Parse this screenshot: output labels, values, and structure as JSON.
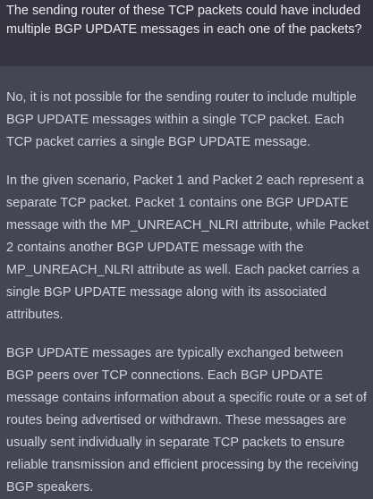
{
  "conversation": {
    "user_message": "The sending router of these TCP packets could have included multiple BGP UPDATE messages in each one of the packets?",
    "assistant_paragraphs": [
      "No, it is not possible for the sending router to include multiple BGP UPDATE messages within a single TCP packet. Each TCP packet carries a single BGP UPDATE message.",
      "In the given scenario, Packet 1 and Packet 2 each represent a separate TCP packet. Packet 1 contains one BGP UPDATE message with the MP_UNREACH_NLRI attribute, while Packet 2 contains another BGP UPDATE message with the MP_UNREACH_NLRI attribute as well. Each packet carries a single BGP UPDATE message along with its associated attributes.",
      "BGP UPDATE messages are typically exchanged between BGP peers over TCP connections. Each BGP UPDATE message contains information about a specific route or a set of routes being advertised or withdrawn. These messages are usually sent individually in separate TCP packets to ensure reliable transmission and efficient processing by the receiving BGP speakers."
    ]
  },
  "colors": {
    "user_background": "#343541",
    "assistant_background": "#444654",
    "user_text": "#ececf1",
    "assistant_text": "#d1d5db"
  }
}
